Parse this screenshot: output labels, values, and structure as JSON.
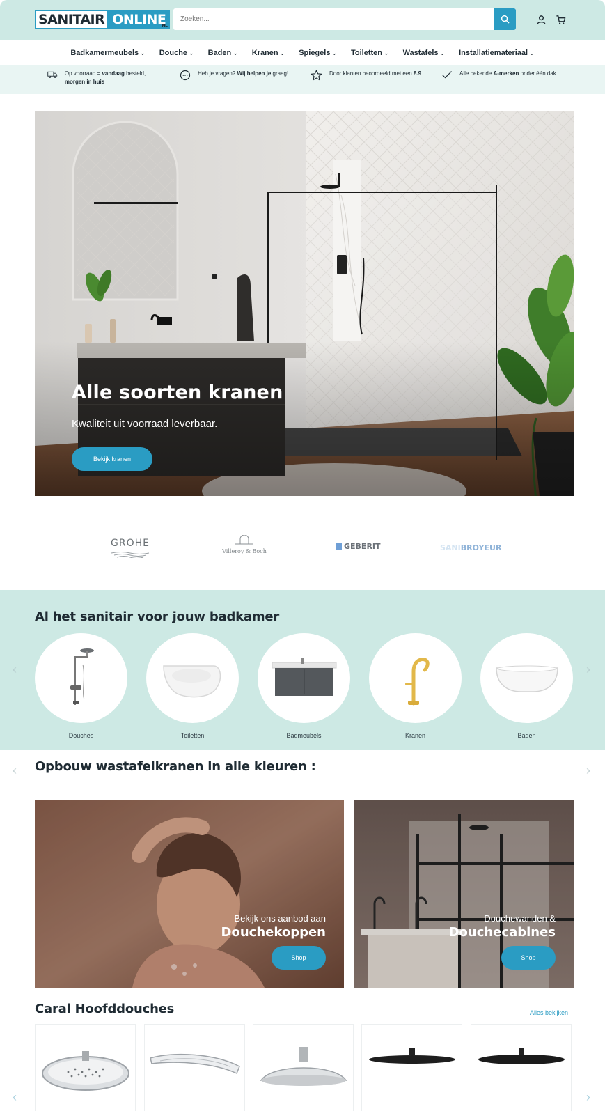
{
  "header": {
    "logo_part1": "SANITAIR",
    "logo_part2": "ONLINE",
    "logo_suffix": "NL",
    "search_placeholder": "Zoeken..."
  },
  "nav": {
    "items": [
      {
        "label": "Badkamermeubels"
      },
      {
        "label": "Douche"
      },
      {
        "label": "Baden"
      },
      {
        "label": "Kranen"
      },
      {
        "label": "Spiegels"
      },
      {
        "label": "Toiletten"
      },
      {
        "label": "Wastafels"
      },
      {
        "label": "Installatiemateriaal"
      }
    ],
    "chevron": "⌄"
  },
  "usp": {
    "items": [
      {
        "icon": "truck-icon",
        "pre": "Op voorraad = ",
        "bold": "vandaag",
        "mid": " besteld, ",
        "bold2": "morgen in huis",
        "post": ""
      },
      {
        "icon": "chat-icon",
        "pre": "Heb je vragen? ",
        "bold": "Wij helpen je",
        "mid": " ",
        "bold2": "",
        "post": "graag!"
      },
      {
        "icon": "star-icon",
        "pre": "Door klanten beoordeeld met een ",
        "bold": "8.9",
        "mid": "",
        "bold2": "",
        "post": ""
      },
      {
        "icon": "check-icon",
        "pre": "Alle bekende ",
        "bold": "A-merken",
        "mid": " onder één dak",
        "bold2": "",
        "post": ""
      }
    ]
  },
  "hero": {
    "title": "Alle soorten kranen",
    "subtitle": "Kwaliteit uit voorraad leverbaar.",
    "button": "Bekijk kranen"
  },
  "brands": {
    "grohe": "GROHE",
    "villeroy": "Villeroy & Boch",
    "geberit": "GEBERIT",
    "sfa_prefix": "SANI",
    "sfa": "BROYEUR"
  },
  "categories": {
    "title": "Al het sanitair voor jouw badkamer",
    "items": [
      {
        "label": "Douches"
      },
      {
        "label": "Toiletten"
      },
      {
        "label": "Badmeubels"
      },
      {
        "label": "Kranen"
      },
      {
        "label": "Baden"
      }
    ]
  },
  "section2": {
    "title": "Opbouw wastafelkranen in alle kleuren :"
  },
  "promos": [
    {
      "subtitle": "Bekijk ons aanbod aan",
      "title": "Douchekoppen",
      "button": "Shop"
    },
    {
      "subtitle": "Douchewanden &",
      "title": "Douchecabines",
      "button": "Shop"
    }
  ],
  "products": {
    "title": "Caral Hoofddouches",
    "view_all": "Alles bekijken"
  },
  "colors": {
    "accent": "#2a9cc3",
    "mint": "#cde9e4",
    "text": "#1f2b33"
  }
}
